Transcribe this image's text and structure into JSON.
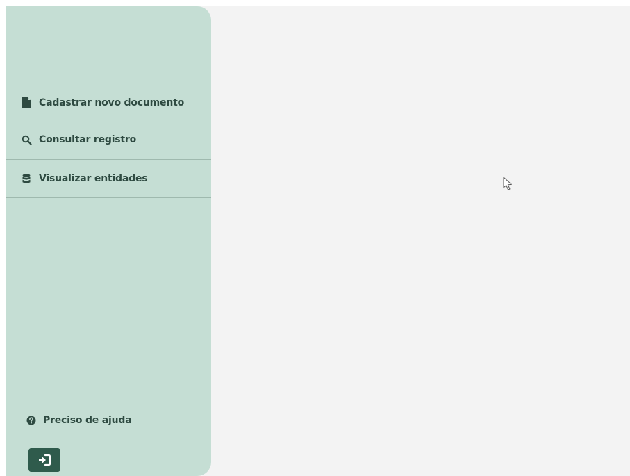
{
  "sidebar": {
    "items": [
      {
        "label": "Cadastrar novo documento",
        "icon": "file-icon"
      },
      {
        "label": "Consultar registro",
        "icon": "search-icon"
      },
      {
        "label": "Visualizar entidades",
        "icon": "database-icon"
      }
    ],
    "help_label": "Preciso de ajuda",
    "help_icon": "question-circle-icon",
    "logout_icon": "sign-out-icon"
  },
  "colors": {
    "sidebar_bg": "#c5ded4",
    "text": "#2e4a41",
    "button_bg": "#2f5b4c",
    "content_bg": "#f3f3f3"
  }
}
